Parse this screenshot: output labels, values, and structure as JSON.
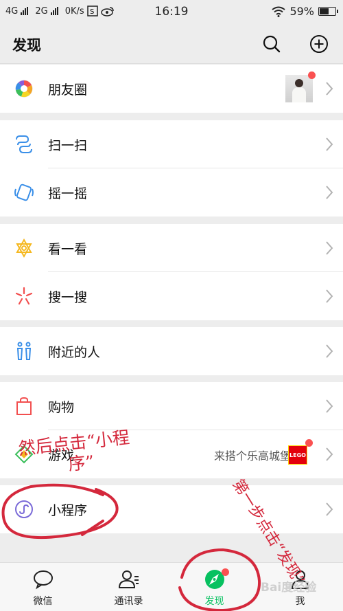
{
  "status_bar": {
    "network_left": "4G",
    "network_right": "2G",
    "speed": "0K/s",
    "time": "16:19",
    "battery": "59%",
    "battery_level": 0.59
  },
  "header": {
    "title": "发现",
    "search_icon": "search-icon",
    "add_icon": "plus-circle-icon"
  },
  "menu": {
    "moments": {
      "label": "朋友圈",
      "icon": "moments-aperture-icon"
    },
    "scan": {
      "label": "扫一扫",
      "icon": "scan-icon"
    },
    "shake": {
      "label": "摇一摇",
      "icon": "shake-icon"
    },
    "top_stories": {
      "label": "看一看",
      "icon": "top-stories-icon"
    },
    "search": {
      "label": "搜一搜",
      "icon": "search-sparkle-icon"
    },
    "nearby": {
      "label": "附近的人",
      "icon": "people-nearby-icon"
    },
    "shopping": {
      "label": "购物",
      "icon": "shopping-bag-icon"
    },
    "games": {
      "label": "游戏",
      "icon": "games-icon",
      "promo_text": "来搭个乐高城堡吗",
      "promo_badge": "LEGO"
    },
    "mini_programs": {
      "label": "小程序",
      "icon": "mini-program-icon"
    }
  },
  "tabs": [
    {
      "label": "微信",
      "icon": "chat-icon"
    },
    {
      "label": "通讯录",
      "icon": "contacts-icon"
    },
    {
      "label": "发现",
      "icon": "discover-compass-icon"
    },
    {
      "label": "我",
      "icon": "me-icon"
    }
  ],
  "annotations": {
    "note1_line1": "然后点击“小程",
    "note1_line2": "序”",
    "note2": "第一步点击“发现”",
    "watermark": "Bai度经验"
  },
  "colors": {
    "accent_green": "#07c160",
    "badge_red": "#fa5151",
    "annotation_red": "#d4283c"
  }
}
